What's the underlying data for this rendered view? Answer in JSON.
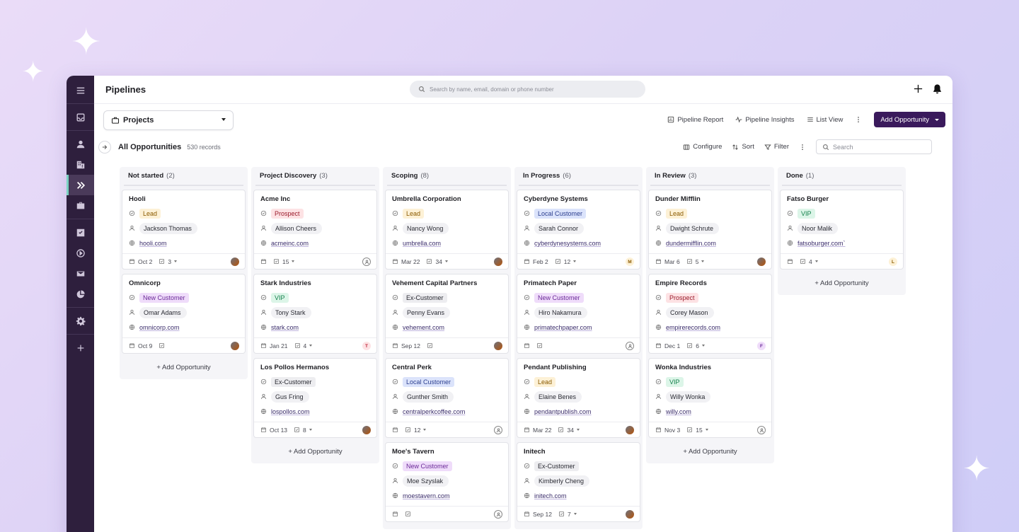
{
  "colors": {
    "sidebar_bg": "#2e1f3d",
    "accent_button": "#3a1a5c",
    "active_indicator": "#7ad3c2"
  },
  "sparkles": [
    "✦",
    "✦",
    "✦"
  ],
  "sidebar": {
    "items": [
      {
        "icon": "menu-icon"
      },
      {
        "icon": "inbox-icon"
      },
      {
        "icon": "person-icon"
      },
      {
        "icon": "building-icon"
      },
      {
        "icon": "pipeline-chevrons-icon",
        "active": true
      },
      {
        "icon": "briefcase-icon"
      },
      {
        "icon": "checkbox-icon"
      },
      {
        "icon": "play-circle-icon"
      },
      {
        "icon": "mail-icon"
      },
      {
        "icon": "pie-chart-icon"
      },
      {
        "icon": "gear-icon"
      },
      {
        "icon": "plus-icon"
      }
    ]
  },
  "topbar": {
    "title": "Pipelines",
    "search_placeholder": "Search by name, email, domain or phone number"
  },
  "toolbar": {
    "project_select": "Projects",
    "pipeline_report": "Pipeline Report",
    "pipeline_insights": "Pipeline Insights",
    "list_view": "List View",
    "add_opportunity": "Add Opportunity"
  },
  "filterbar": {
    "title": "All Opportunities",
    "record_count": "530 records",
    "configure": "Configure",
    "sort": "Sort",
    "filter": "Filter",
    "search_placeholder": "Search"
  },
  "board": {
    "add_label": "+ Add Opportunity",
    "columns": [
      {
        "name": "Not started",
        "count": "(2)",
        "cards": [
          {
            "name": "Hooli",
            "tag": "Lead",
            "tag_color": "lead",
            "contact": "Jackson Thomas",
            "domain": "hooli.com",
            "date": "Oct 2",
            "tasks": "3",
            "avatar": "photo"
          },
          {
            "name": "Omnicorp",
            "tag": "New Customer",
            "tag_color": "new",
            "contact": "Omar Adams",
            "domain": "omnicorp.com",
            "date": "Oct 9",
            "tasks": "",
            "avatar": "photo"
          }
        ]
      },
      {
        "name": "Project Discovery",
        "count": "(3)",
        "cards": [
          {
            "name": "Acme Inc",
            "tag": "Prospect",
            "tag_color": "prospect",
            "contact": "Allison Cheers",
            "domain": "acmeinc.com",
            "date": "",
            "tasks": "15",
            "avatar": "outline"
          },
          {
            "name": "Stark Industries",
            "tag": "VIP",
            "tag_color": "vip",
            "contact": "Tony Stark",
            "domain": "stark.com",
            "date": "Jan 21",
            "tasks": "4",
            "avatar": "T"
          },
          {
            "name": "Los Pollos Hermanos",
            "tag": "Ex-Customer",
            "tag_color": "ex",
            "contact": "Gus Fring",
            "domain": "lospollos.com",
            "date": "Oct 13",
            "tasks": "8",
            "avatar": "photo"
          }
        ]
      },
      {
        "name": "Scoping",
        "count": "(8)",
        "cards": [
          {
            "name": "Umbrella Corporation",
            "tag": "Lead",
            "tag_color": "lead",
            "contact": "Nancy Wong",
            "domain": "umbrella.com",
            "date": "Mar 22",
            "tasks": "34",
            "avatar": "photo"
          },
          {
            "name": "Vehement Capital Partners",
            "tag": "Ex-Customer",
            "tag_color": "ex",
            "contact": "Penny Evans",
            "domain": "vehement.com",
            "date": "Sep 12",
            "tasks": "",
            "avatar": "photo"
          },
          {
            "name": "Central Perk",
            "tag": "Local Customer",
            "tag_color": "local",
            "contact": "Gunther Smith",
            "domain": "centralperkcoffee.com",
            "date": "",
            "tasks": "12",
            "avatar": "outline"
          },
          {
            "name": "Moe's Tavern",
            "tag": "New Customer",
            "tag_color": "new",
            "contact": "Moe Szyslak",
            "domain": "moestavern.com",
            "date": "",
            "tasks": "",
            "avatar": "outline"
          }
        ]
      },
      {
        "name": "In Progress",
        "count": "(6)",
        "cards": [
          {
            "name": "Cyberdyne Systems",
            "tag": "Local Customer",
            "tag_color": "local",
            "contact": "Sarah Connor",
            "domain": "cyberdynesystems.com",
            "date": "Feb 2",
            "tasks": "12",
            "avatar": "M"
          },
          {
            "name": "Primatech Paper",
            "tag": "New Customer",
            "tag_color": "new",
            "contact": "Hiro Nakamura",
            "domain": "primatechpaper.com",
            "date": "",
            "tasks": "",
            "avatar": "outline"
          },
          {
            "name": "Pendant Publishing",
            "tag": "Lead",
            "tag_color": "lead",
            "contact": "Elaine Benes",
            "domain": "pendantpublish.com",
            "date": "Mar 22",
            "tasks": "34",
            "avatar": "photo"
          },
          {
            "name": "Initech",
            "tag": "Ex-Customer",
            "tag_color": "ex",
            "contact": "Kimberly Cheng",
            "domain": "initech.com",
            "date": "Sep 12",
            "tasks": "7",
            "avatar": "photo"
          }
        ]
      },
      {
        "name": "In Review",
        "count": "(3)",
        "cards": [
          {
            "name": "Dunder Mifflin",
            "tag": "Lead",
            "tag_color": "lead",
            "contact": "Dwight Schrute",
            "domain": "dundermifflin.com",
            "date": "Mar 6",
            "tasks": "5",
            "avatar": "photo"
          },
          {
            "name": "Empire Records",
            "tag": "Prospect",
            "tag_color": "prospect",
            "contact": "Corey Mason",
            "domain": "empirerecords.com",
            "date": "Dec 1",
            "tasks": "6",
            "avatar": "F"
          },
          {
            "name": "Wonka Industries",
            "tag": "VIP",
            "tag_color": "vip",
            "contact": "Willy Wonka",
            "domain": "willy.com",
            "date": "Nov 3",
            "tasks": "15",
            "avatar": "outline"
          }
        ]
      },
      {
        "name": "Done",
        "count": "(1)",
        "cards": [
          {
            "name": "Fatso Burger",
            "tag": "VIP",
            "tag_color": "vip",
            "contact": "Noor Malik",
            "domain": "fatsoburger.com`",
            "date": "",
            "tasks": "4",
            "avatar": "L"
          }
        ]
      }
    ]
  }
}
